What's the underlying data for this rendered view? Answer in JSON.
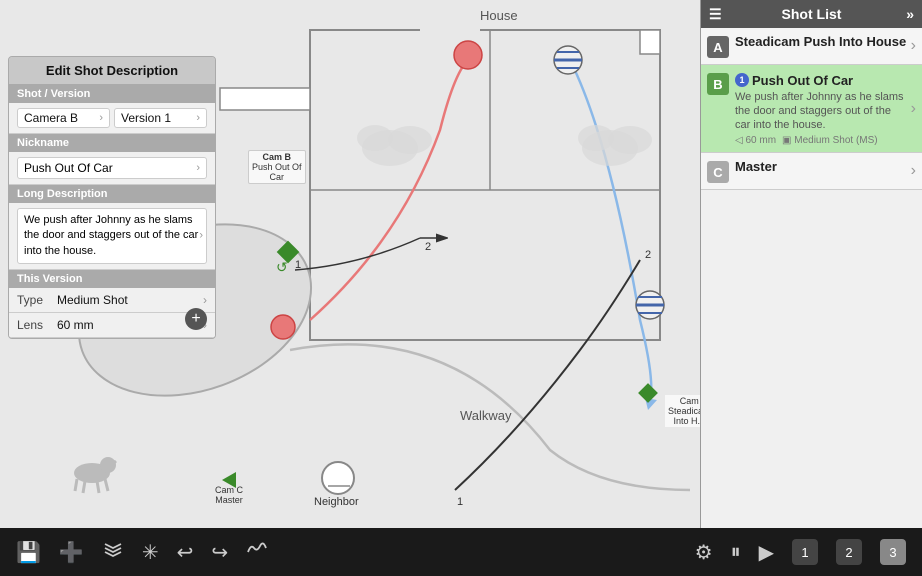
{
  "app": {
    "title": "Shot List"
  },
  "edit_panel": {
    "header": "Edit Shot Description",
    "section_shot": "Shot / Version",
    "camera_label": "Camera B",
    "version_label": "Version 1",
    "section_nickname": "Nickname",
    "nickname_value": "Push Out Of Car",
    "section_long_desc": "Long Description",
    "long_desc_value": "We push after Johnny as he slams the door and staggers out of the car into the house.",
    "section_this_version": "This Version",
    "type_label": "Type",
    "type_value": "Medium Shot",
    "lens_label": "Lens",
    "lens_value": "60 mm"
  },
  "shot_list": {
    "header": "Shot List",
    "shots": [
      {
        "letter": "A",
        "title": "Steadicam Push Into House",
        "desc": "",
        "meta": [],
        "highlighted": false
      },
      {
        "letter": "B",
        "title": "Push Out Of Car",
        "desc": "We push after Johnny as he slams the door and staggers out of the car into the house.",
        "meta": [
          "60 mm",
          "Medium Shot (MS)"
        ],
        "highlighted": true
      },
      {
        "letter": "C",
        "title": "Master",
        "desc": "",
        "meta": [],
        "highlighted": false
      }
    ]
  },
  "canvas": {
    "house_label": "House",
    "walkway_label": "Walkway",
    "cam_b_label": "Cam B\nPush Out Of\nCar",
    "cam_c_label": "Cam C\nMaster",
    "cam_steadicam_label": "Cam\nSteadicam\nInto H...",
    "neighbor_label": "Neighbor"
  },
  "toolbar": {
    "icons": [
      "💾",
      "➕",
      "≡",
      "✳",
      "↩",
      "↪",
      "〰"
    ],
    "mid_icons": [
      "⚙",
      "⏸",
      "▶"
    ],
    "pages": [
      "1",
      "2",
      "3"
    ]
  }
}
